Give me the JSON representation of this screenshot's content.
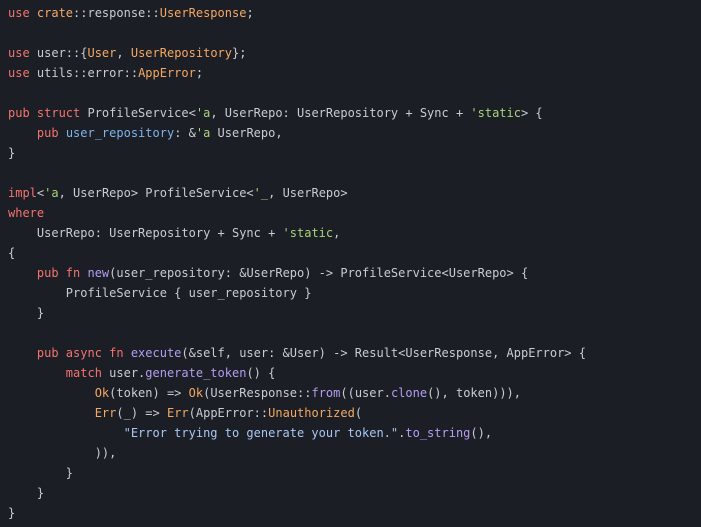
{
  "editor": {
    "background": "#1b1e24",
    "colors": {
      "keyword": "#f4736f",
      "type": "#f5a864",
      "function": "#b59cf2",
      "string": "#a9c7f4",
      "lifetime": "#a9d37a",
      "field": "#7fb3ee",
      "text": "#c9ccd3"
    },
    "lines": [
      [
        {
          "t": "use ",
          "c": "kw"
        },
        {
          "t": "crate",
          "c": "ty"
        },
        {
          "t": "::response::",
          "c": "punc"
        },
        {
          "t": "UserResponse",
          "c": "ty"
        },
        {
          "t": ";",
          "c": "punc"
        }
      ],
      [],
      [
        {
          "t": "use ",
          "c": "kw"
        },
        {
          "t": "user::{",
          "c": "punc"
        },
        {
          "t": "User",
          "c": "ty"
        },
        {
          "t": ", ",
          "c": "punc"
        },
        {
          "t": "UserRepository",
          "c": "ty"
        },
        {
          "t": "};",
          "c": "punc"
        }
      ],
      [
        {
          "t": "use ",
          "c": "kw"
        },
        {
          "t": "utils::error::",
          "c": "punc"
        },
        {
          "t": "AppError",
          "c": "ty"
        },
        {
          "t": ";",
          "c": "punc"
        }
      ],
      [],
      [
        {
          "t": "pub struct ",
          "c": "kw"
        },
        {
          "t": "ProfileService<",
          "c": "punc"
        },
        {
          "t": "'a",
          "c": "lt"
        },
        {
          "t": ", UserRepo: UserRepository + Sync + ",
          "c": "punc"
        },
        {
          "t": "'static",
          "c": "lt"
        },
        {
          "t": "> {",
          "c": "punc"
        }
      ],
      [
        {
          "t": "    ",
          "c": "punc"
        },
        {
          "t": "pub ",
          "c": "kw"
        },
        {
          "t": "user_repository",
          "c": "field"
        },
        {
          "t": ": &",
          "c": "punc"
        },
        {
          "t": "'a",
          "c": "lt"
        },
        {
          "t": " UserRepo,",
          "c": "punc"
        }
      ],
      [
        {
          "t": "}",
          "c": "punc"
        }
      ],
      [],
      [
        {
          "t": "impl",
          "c": "kw"
        },
        {
          "t": "<",
          "c": "punc"
        },
        {
          "t": "'a",
          "c": "lt"
        },
        {
          "t": ", UserRepo> ProfileService<",
          "c": "punc"
        },
        {
          "t": "'_",
          "c": "lt"
        },
        {
          "t": ", UserRepo>",
          "c": "punc"
        }
      ],
      [
        {
          "t": "where",
          "c": "kw"
        }
      ],
      [
        {
          "t": "    UserRepo: UserRepository + Sync + ",
          "c": "punc"
        },
        {
          "t": "'static",
          "c": "lt"
        },
        {
          "t": ",",
          "c": "punc"
        }
      ],
      [
        {
          "t": "{",
          "c": "punc"
        }
      ],
      [
        {
          "t": "    ",
          "c": "punc"
        },
        {
          "t": "pub fn ",
          "c": "kw"
        },
        {
          "t": "new",
          "c": "fn"
        },
        {
          "t": "(user_repository: &UserRepo) -> ProfileService<UserRepo> {",
          "c": "punc"
        }
      ],
      [
        {
          "t": "        ProfileService { user_repository }",
          "c": "punc"
        }
      ],
      [
        {
          "t": "    }",
          "c": "punc"
        }
      ],
      [],
      [
        {
          "t": "    ",
          "c": "punc"
        },
        {
          "t": "pub async fn ",
          "c": "kw"
        },
        {
          "t": "execute",
          "c": "fn"
        },
        {
          "t": "(&self, user: &User) -> Result<UserResponse, AppError> {",
          "c": "punc"
        }
      ],
      [
        {
          "t": "        ",
          "c": "punc"
        },
        {
          "t": "match ",
          "c": "kw"
        },
        {
          "t": "user.",
          "c": "punc"
        },
        {
          "t": "generate_token",
          "c": "fn"
        },
        {
          "t": "() {",
          "c": "punc"
        }
      ],
      [
        {
          "t": "            ",
          "c": "punc"
        },
        {
          "t": "Ok",
          "c": "mac"
        },
        {
          "t": "(token) => ",
          "c": "punc"
        },
        {
          "t": "Ok",
          "c": "mac"
        },
        {
          "t": "(UserResponse::",
          "c": "punc"
        },
        {
          "t": "from",
          "c": "fn"
        },
        {
          "t": "((user.",
          "c": "punc"
        },
        {
          "t": "clone",
          "c": "fn"
        },
        {
          "t": "(), token))),",
          "c": "punc"
        }
      ],
      [
        {
          "t": "            ",
          "c": "punc"
        },
        {
          "t": "Err",
          "c": "mac"
        },
        {
          "t": "(_) => ",
          "c": "punc"
        },
        {
          "t": "Err",
          "c": "mac"
        },
        {
          "t": "(AppError::",
          "c": "punc"
        },
        {
          "t": "Unauthorized",
          "c": "ty"
        },
        {
          "t": "(",
          "c": "punc"
        }
      ],
      [
        {
          "t": "                ",
          "c": "punc"
        },
        {
          "t": "\"Error trying to generate your token.\"",
          "c": "str"
        },
        {
          "t": ".",
          "c": "punc"
        },
        {
          "t": "to_string",
          "c": "fn"
        },
        {
          "t": "(),",
          "c": "punc"
        }
      ],
      [
        {
          "t": "            )),",
          "c": "punc"
        }
      ],
      [
        {
          "t": "        }",
          "c": "punc"
        }
      ],
      [
        {
          "t": "    }",
          "c": "punc"
        }
      ],
      [
        {
          "t": "}",
          "c": "punc"
        }
      ]
    ]
  }
}
